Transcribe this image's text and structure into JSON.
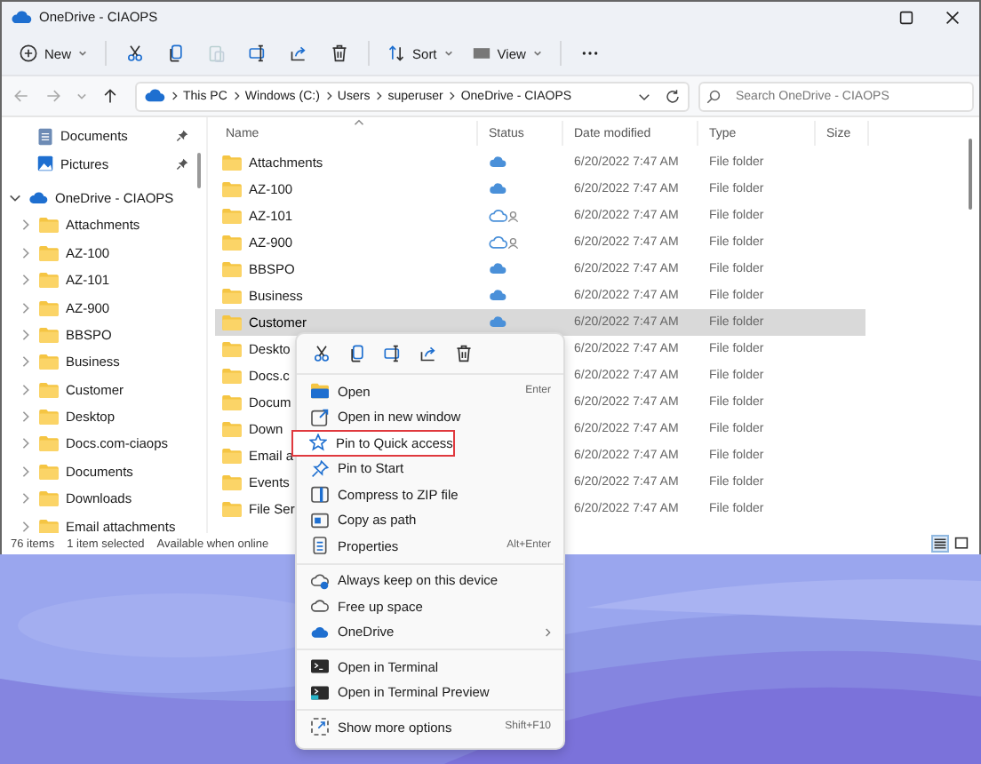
{
  "window": {
    "title": "OneDrive - CIAOPS"
  },
  "toolbar": {
    "new_label": "New",
    "sort_label": "Sort",
    "view_label": "View"
  },
  "address": {
    "path": [
      "This PC",
      "Windows (C:)",
      "Users",
      "superuser",
      "OneDrive - CIAOPS"
    ]
  },
  "search": {
    "placeholder": "Search OneDrive - CIAOPS"
  },
  "sidebar": {
    "quick": [
      {
        "label": "Documents",
        "kind": "documents",
        "pinned": true
      },
      {
        "label": "Pictures",
        "kind": "pictures",
        "pinned": true
      }
    ],
    "tree": {
      "label": "OneDrive - CIAOPS",
      "expanded": true,
      "children": [
        {
          "label": "Attachments",
          "expanded": false
        },
        {
          "label": "AZ-100",
          "expanded": false
        },
        {
          "label": "AZ-101",
          "expanded": false
        },
        {
          "label": "AZ-900",
          "expanded": false
        },
        {
          "label": "BBSPO",
          "expanded": false
        },
        {
          "label": "Business",
          "expanded": false
        },
        {
          "label": "Customer",
          "expanded": false
        },
        {
          "label": "Desktop",
          "expanded": false
        },
        {
          "label": "Docs.com-ciaops",
          "expanded": false
        },
        {
          "label": "Documents",
          "expanded": false
        },
        {
          "label": "Downloads",
          "expanded": false
        },
        {
          "label": "Email attachments",
          "expanded": false
        }
      ]
    }
  },
  "table": {
    "columns": [
      "Name",
      "Status",
      "Date modified",
      "Type",
      "Size"
    ],
    "rows": [
      {
        "name": "Attachments",
        "kind": "online",
        "date": "6/20/2022 7:47 AM",
        "type": "File folder",
        "selected": false
      },
      {
        "name": "AZ-100",
        "kind": "online",
        "date": "6/20/2022 7:47 AM",
        "type": "File folder",
        "selected": false
      },
      {
        "name": "AZ-101",
        "kind": "shared",
        "date": "6/20/2022 7:47 AM",
        "type": "File folder",
        "selected": false
      },
      {
        "name": "AZ-900",
        "kind": "shared",
        "date": "6/20/2022 7:47 AM",
        "type": "File folder",
        "selected": false
      },
      {
        "name": "BBSPO",
        "kind": "online",
        "date": "6/20/2022 7:47 AM",
        "type": "File folder",
        "selected": false
      },
      {
        "name": "Business",
        "kind": "online",
        "date": "6/20/2022 7:47 AM",
        "type": "File folder",
        "selected": false
      },
      {
        "name": "Customer",
        "kind": "online",
        "date": "6/20/2022 7:47 AM",
        "type": "File folder",
        "selected": true
      },
      {
        "name": "Deskto",
        "date": "6/20/2022 7:47 AM",
        "type": "File folder",
        "selected": false
      },
      {
        "name": "Docs.c",
        "date": "6/20/2022 7:47 AM",
        "type": "File folder",
        "selected": false
      },
      {
        "name": "Docum",
        "date": "6/20/2022 7:47 AM",
        "type": "File folder",
        "selected": false
      },
      {
        "name": "Down",
        "date": "6/20/2022 7:47 AM",
        "type": "File folder",
        "selected": false
      },
      {
        "name": "Email a",
        "date": "6/20/2022 7:47 AM",
        "type": "File folder",
        "selected": false
      },
      {
        "name": "Events",
        "date": "6/20/2022 7:47 AM",
        "type": "File folder",
        "selected": false
      },
      {
        "name": "File Ser",
        "date": "6/20/2022 7:47 AM",
        "type": "File folder",
        "selected": false
      }
    ]
  },
  "status_bar": {
    "items": [
      "76 items",
      "1 item selected",
      "Available when online"
    ]
  },
  "view_buttons": [
    {
      "kind": "details",
      "selected": true
    },
    {
      "kind": "tiles",
      "selected": false
    }
  ],
  "context_menu": {
    "groups": [
      {
        "items": [
          {
            "label": "Open",
            "kind": "open",
            "shortcut": "Enter",
            "highlighted": false
          },
          {
            "label": "Open in new window",
            "kind": "new-window",
            "highlighted": false
          },
          {
            "label": "Pin to Quick access",
            "kind": "star",
            "highlighted": true
          },
          {
            "label": "Pin to Start",
            "kind": "pin",
            "highlighted": false
          },
          {
            "label": "Compress to ZIP file",
            "kind": "zip",
            "highlighted": false
          },
          {
            "label": "Copy as path",
            "kind": "path",
            "highlighted": false
          },
          {
            "label": "Properties",
            "kind": "properties",
            "shortcut": "Alt+Enter",
            "highlighted": false
          }
        ]
      },
      {
        "items": [
          {
            "label": "Always keep on this device",
            "kind": "cloud-keep",
            "highlighted": false
          },
          {
            "label": "Free up space",
            "kind": "cloud",
            "highlighted": false
          },
          {
            "label": "OneDrive",
            "kind": "onedrive",
            "submenu": true,
            "highlighted": false
          }
        ]
      },
      {
        "items": [
          {
            "label": "Open in Terminal",
            "kind": "terminal",
            "highlighted": false
          },
          {
            "label": "Open in Terminal Preview",
            "kind": "terminal-preview",
            "highlighted": false
          }
        ]
      },
      {
        "items": [
          {
            "label": "Show more options",
            "kind": "more",
            "shortcut": "Shift+F10",
            "highlighted": false
          }
        ]
      }
    ]
  }
}
